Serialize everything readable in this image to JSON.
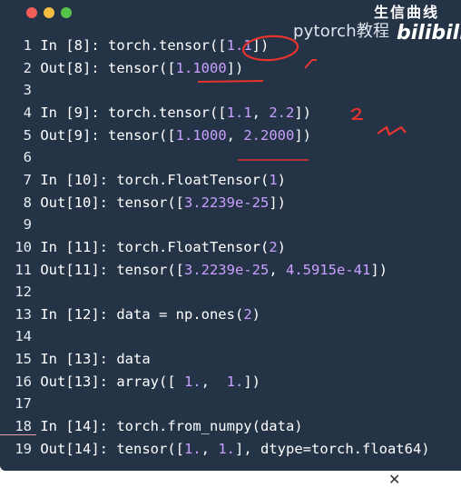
{
  "window": {
    "buttons": [
      "close",
      "minimize",
      "maximize"
    ],
    "colors": {
      "background": "#253346",
      "number": "#c9a0ff",
      "annotation": "#e8332e"
    }
  },
  "watermark": {
    "text": "pytorch教程",
    "top_logo": "生信曲线",
    "logo": "bilibili"
  },
  "code_lines": [
    {
      "n": "1",
      "parts": [
        {
          "t": "In [8]: torch.tensor([",
          "c": "kw"
        },
        {
          "t": "1.1",
          "c": "num"
        },
        {
          "t": "])",
          "c": "kw"
        }
      ]
    },
    {
      "n": "2",
      "parts": [
        {
          "t": "Out[8]: tensor([",
          "c": "kw"
        },
        {
          "t": "1.1000",
          "c": "num"
        },
        {
          "t": "])",
          "c": "kw"
        }
      ]
    },
    {
      "n": "3",
      "parts": []
    },
    {
      "n": "4",
      "parts": [
        {
          "t": "In [9]: torch.tensor([",
          "c": "kw"
        },
        {
          "t": "1.1",
          "c": "num"
        },
        {
          "t": ", ",
          "c": "kw"
        },
        {
          "t": "2.2",
          "c": "num"
        },
        {
          "t": "])",
          "c": "kw"
        }
      ]
    },
    {
      "n": "5",
      "parts": [
        {
          "t": "Out[9]: tensor([",
          "c": "kw"
        },
        {
          "t": "1.1000",
          "c": "num"
        },
        {
          "t": ", ",
          "c": "kw"
        },
        {
          "t": "2.2000",
          "c": "num"
        },
        {
          "t": "])",
          "c": "kw"
        }
      ]
    },
    {
      "n": "6",
      "parts": []
    },
    {
      "n": "7",
      "parts": [
        {
          "t": "In [10]: torch.FloatTensor(",
          "c": "kw"
        },
        {
          "t": "1",
          "c": "num"
        },
        {
          "t": ")",
          "c": "kw"
        }
      ]
    },
    {
      "n": "8",
      "parts": [
        {
          "t": "Out[10]: tensor([",
          "c": "kw"
        },
        {
          "t": "3.2239e-25",
          "c": "num"
        },
        {
          "t": "])",
          "c": "kw"
        }
      ]
    },
    {
      "n": "9",
      "parts": []
    },
    {
      "n": "10",
      "parts": [
        {
          "t": "In [11]: torch.FloatTensor(",
          "c": "kw"
        },
        {
          "t": "2",
          "c": "num"
        },
        {
          "t": ")",
          "c": "kw"
        }
      ]
    },
    {
      "n": "11",
      "parts": [
        {
          "t": "Out[11]: tensor([",
          "c": "kw"
        },
        {
          "t": "3.2239e-25",
          "c": "num"
        },
        {
          "t": ", ",
          "c": "kw"
        },
        {
          "t": "4.5915e-41",
          "c": "num"
        },
        {
          "t": "])",
          "c": "kw"
        }
      ]
    },
    {
      "n": "12",
      "parts": []
    },
    {
      "n": "13",
      "parts": [
        {
          "t": "In [12]: data = np.ones(",
          "c": "kw"
        },
        {
          "t": "2",
          "c": "num"
        },
        {
          "t": ")",
          "c": "kw"
        }
      ]
    },
    {
      "n": "14",
      "parts": []
    },
    {
      "n": "15",
      "parts": [
        {
          "t": "In [13]: data",
          "c": "kw"
        }
      ]
    },
    {
      "n": "16",
      "parts": [
        {
          "t": "Out[13]: array([ ",
          "c": "kw"
        },
        {
          "t": "1.",
          "c": "num"
        },
        {
          "t": ",  ",
          "c": "kw"
        },
        {
          "t": "1.",
          "c": "num"
        },
        {
          "t": "])",
          "c": "kw"
        }
      ]
    },
    {
      "n": "17",
      "parts": []
    },
    {
      "n": "18",
      "parts": [
        {
          "t": "In [14]: torch.from_numpy(data)",
          "c": "kw"
        }
      ]
    },
    {
      "n": "19",
      "parts": [
        {
          "t": "Out[14]: tensor([",
          "c": "kw"
        },
        {
          "t": "1.",
          "c": "num"
        },
        {
          "t": ", ",
          "c": "kw"
        },
        {
          "t": "1.",
          "c": "num"
        },
        {
          "t": "], dtype=torch.float64)",
          "c": "kw"
        }
      ]
    }
  ]
}
